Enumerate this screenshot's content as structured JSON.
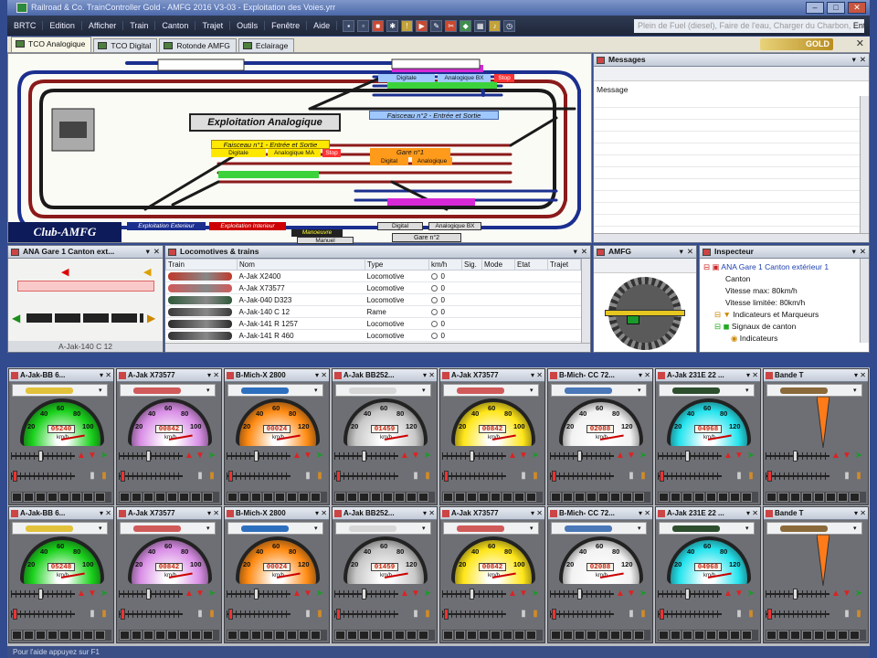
{
  "window": {
    "title": "Railroad & Co. TrainController Gold - AMFG 2016 V3-03 - Exploitation des Voies.yrr"
  },
  "menu": [
    "BRTC",
    "Edition",
    "Afficher",
    "Train",
    "Canton",
    "Trajet",
    "Outils",
    "Fenêtre",
    "Aide"
  ],
  "message_line": {
    "prefix": "Plein de Fuel (diesel), Faire de l'eau, Charger du Charbon, ",
    "current": "Entretien..."
  },
  "tabs": [
    {
      "label": "TCO Analogique",
      "active": true
    },
    {
      "label": "TCO Digital",
      "active": false
    },
    {
      "label": "Rotonde AMFG",
      "active": false
    },
    {
      "label": "Eclairage",
      "active": false
    }
  ],
  "brand": "GOLD",
  "tco": {
    "title": "Exploitation Analogique",
    "club": "Club-AMFG",
    "labels": {
      "digitale": "Digitale",
      "analogique_ma": "Analogique MA",
      "analogique_bx": "Analogique BX",
      "stop": "Stop",
      "faisceau1": "Faisceau n°1 - Entrée et Sortie",
      "faisceau2": "Faisceau n°2 - Entrée et Sortie",
      "gare1": "Gare n°1",
      "gare2": "Gare n°2",
      "digital": "Digital",
      "analogique": "Analogique",
      "expl_ext": "Exploitation Exterieur",
      "expl_int": "Exploitation Interieur",
      "manoeuvre": "Manoeuvre",
      "manuel": "Manuel"
    }
  },
  "messages": {
    "title": "Messages",
    "column": "Message"
  },
  "block_panel": {
    "title": "ANA Gare 1 Canton ext...",
    "train": "A-Jak-140 C 12"
  },
  "loco_list": {
    "title": "Locomotives & trains",
    "columns": [
      "Train",
      "Nom",
      "Type",
      "km/h",
      "Sig.",
      "Mode",
      "Etat",
      "Trajet"
    ],
    "rows": [
      {
        "name": "A-Jak X2400",
        "type": "Locomotive",
        "speed": "0",
        "color": "#c0392b"
      },
      {
        "name": "A-Jak X73577",
        "type": "Locomotive",
        "speed": "0",
        "color": "#d05a5a"
      },
      {
        "name": "A-Jak-040 D323",
        "type": "Locomotive",
        "speed": "0",
        "color": "#2f5a3a"
      },
      {
        "name": "A-Jak-140 C 12",
        "type": "Rame",
        "speed": "0",
        "color": "#3a3a3a"
      },
      {
        "name": "A-Jak-141 R 1257",
        "type": "Locomotive",
        "speed": "0",
        "color": "#2c2c2c"
      },
      {
        "name": "A-Jak-141 R 460",
        "type": "Locomotive",
        "speed": "0",
        "color": "#333"
      }
    ]
  },
  "turntable": {
    "title": "AMFG"
  },
  "inspector": {
    "title": "Inspecteur",
    "rows": [
      {
        "text": "ANA Gare 1 Canton extérieur 1",
        "level": 0,
        "link": true
      },
      {
        "text": "Canton",
        "level": 1,
        "link": false
      },
      {
        "text": "Vitesse max: 80km/h",
        "level": 1,
        "link": false
      },
      {
        "text": "Vitesse limitée: 80km/h",
        "level": 1,
        "link": false
      },
      {
        "text": "Indicateurs et Marqueurs",
        "level": 1,
        "link": false
      },
      {
        "text": "Signaux de canton",
        "level": 1,
        "link": false
      },
      {
        "text": "Indicateurs",
        "level": 2,
        "link": false
      }
    ]
  },
  "cabs_top": [
    {
      "title": "A-Jak-BB 6...",
      "odo": "05240",
      "face": "#19d11b",
      "max": "100",
      "loco": "#e2c23a"
    },
    {
      "title": "A-Jak X73577",
      "odo": "00842",
      "face": "#d98ee6",
      "max": "100",
      "loco": "#d05a5a"
    },
    {
      "title": "B-Mich-X 2800",
      "odo": "00024",
      "face": "#ff8a12",
      "max": "120",
      "loco": "#2d6fbf"
    },
    {
      "title": "A-Jak BB252...",
      "odo": "01459",
      "face": "#c8c8c8",
      "max": "120",
      "loco": "#d7d7d7"
    },
    {
      "title": "A-Jak X73577",
      "odo": "00842",
      "face": "#ffe619",
      "max": "100",
      "loco": "#d05a5a"
    },
    {
      "title": "B-Mich- CC 72...",
      "odo": "02088",
      "face": "#f2f2f2",
      "max": "120",
      "loco": "#4a78b8"
    },
    {
      "title": "A-Jak 231E 22 ...",
      "odo": "04968",
      "face": "#25e4ee",
      "max": "120",
      "loco": "#2e4f2e"
    },
    {
      "title": "Bande T",
      "odo": "",
      "face": "",
      "max": "",
      "loco": "#8a6a3a"
    }
  ],
  "cabs_bottom": [
    {
      "title": "A-Jak-BB 6...",
      "odo": "05248",
      "face": "#19d11b",
      "max": "100",
      "loco": "#e2c23a"
    },
    {
      "title": "A-Jak X73577",
      "odo": "00842",
      "face": "#d98ee6",
      "max": "100",
      "loco": "#d05a5a"
    },
    {
      "title": "B-Mich-X 2800",
      "odo": "00024",
      "face": "#ff8a12",
      "max": "120",
      "loco": "#2d6fbf"
    },
    {
      "title": "A-Jak BB252...",
      "odo": "01459",
      "face": "#c8c8c8",
      "max": "120",
      "loco": "#d7d7d7"
    },
    {
      "title": "A-Jak X73577",
      "odo": "00842",
      "face": "#ffe619",
      "max": "100",
      "loco": "#d05a5a"
    },
    {
      "title": "B-Mich- CC 72...",
      "odo": "02088",
      "face": "#f2f2f2",
      "max": "120",
      "loco": "#4a78b8"
    },
    {
      "title": "A-Jak 231E 22 ...",
      "odo": "04968",
      "face": "#25e4ee",
      "max": "120",
      "loco": "#2e4f2e"
    },
    {
      "title": "Bande T",
      "odo": "",
      "face": "",
      "max": "",
      "loco": "#8a6a3a"
    }
  ],
  "gauge_ticks": [
    "20",
    "40",
    "60",
    "80"
  ],
  "gauge_unit": "km/h",
  "status": "Pour l'aide appuyez sur F1"
}
